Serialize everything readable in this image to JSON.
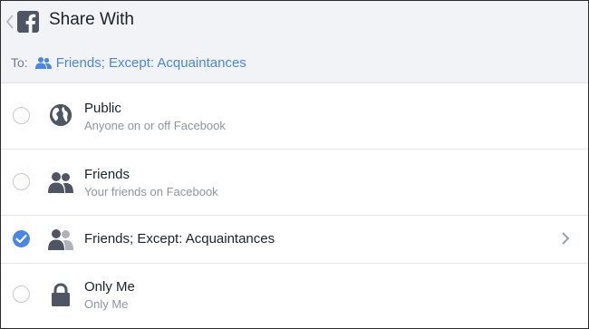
{
  "header": {
    "title": "Share With",
    "to_label": "To:",
    "to_value": "Friends; Except: Acquaintances"
  },
  "options": [
    {
      "title": "Public",
      "subtitle": "Anyone on or off Facebook",
      "icon": "globe-icon",
      "selected": false
    },
    {
      "title": "Friends",
      "subtitle": "Your friends on Facebook",
      "icon": "friends-icon",
      "selected": false
    },
    {
      "title": "Friends; Except: Acquaintances",
      "subtitle": "",
      "icon": "friends-except-icon",
      "selected": true
    },
    {
      "title": "Only Me",
      "subtitle": "Only Me",
      "icon": "lock-icon",
      "selected": false
    }
  ],
  "colors": {
    "accent": "#4a86e8",
    "header_bg": "#f1f3f7",
    "icon_gray": "#4f5663",
    "muted_text": "#90949c"
  }
}
